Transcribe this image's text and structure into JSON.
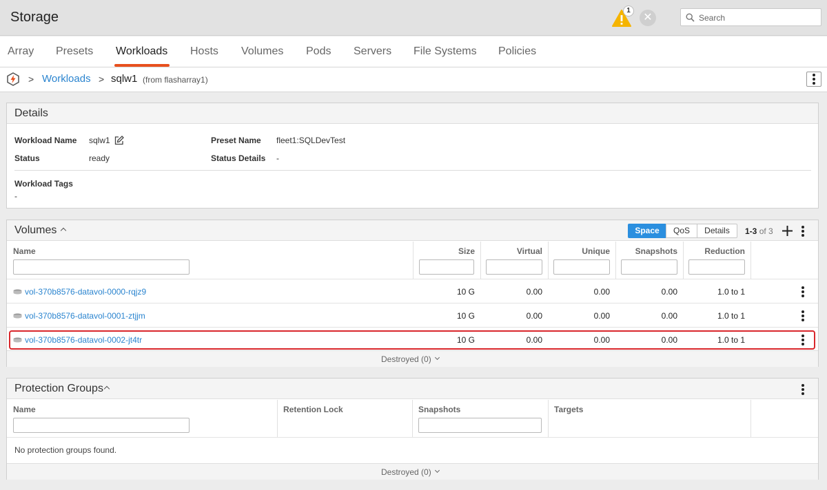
{
  "app": {
    "title": "Storage"
  },
  "header": {
    "alert_count": "1",
    "search_placeholder": "Search"
  },
  "tabs": [
    {
      "label": "Array"
    },
    {
      "label": "Presets"
    },
    {
      "label": "Workloads",
      "active": true
    },
    {
      "label": "Hosts"
    },
    {
      "label": "Volumes"
    },
    {
      "label": "Pods"
    },
    {
      "label": "Servers"
    },
    {
      "label": "File Systems"
    },
    {
      "label": "Policies"
    }
  ],
  "breadcrumb": {
    "sep": ">",
    "parent": "Workloads",
    "current": "sqlw1",
    "source": "(from flasharray1)"
  },
  "details": {
    "title": "Details",
    "workload_name_label": "Workload Name",
    "workload_name": "sqlw1",
    "status_label": "Status",
    "status": "ready",
    "preset_name_label": "Preset Name",
    "preset_name": "fleet1:SQLDevTest",
    "status_details_label": "Status Details",
    "status_details": "-",
    "tags_label": "Workload Tags",
    "tags": "-"
  },
  "volumes": {
    "title": "Volumes",
    "views": [
      "Space",
      "QoS",
      "Details"
    ],
    "active_view": "Space",
    "pagination": {
      "range": "1-3",
      "of": "of 3"
    },
    "columns": [
      "Name",
      "Size",
      "Virtual",
      "Unique",
      "Snapshots",
      "Reduction"
    ],
    "rows": [
      {
        "name": "vol-370b8576-datavol-0000-rqjz9",
        "size": "10 G",
        "virtual": "0.00",
        "unique": "0.00",
        "snapshots": "0.00",
        "reduction": "1.0 to 1"
      },
      {
        "name": "vol-370b8576-datavol-0001-ztjjm",
        "size": "10 G",
        "virtual": "0.00",
        "unique": "0.00",
        "snapshots": "0.00",
        "reduction": "1.0 to 1"
      },
      {
        "name": "vol-370b8576-datavol-0002-jt4tr",
        "size": "10 G",
        "virtual": "0.00",
        "unique": "0.00",
        "snapshots": "0.00",
        "reduction": "1.0 to 1",
        "highlighted": true
      }
    ],
    "destroyed": "Destroyed (0)"
  },
  "protection_groups": {
    "title": "Protection Groups",
    "columns": [
      "Name",
      "Retention Lock",
      "Snapshots",
      "Targets"
    ],
    "empty_text": "No protection groups found.",
    "destroyed": "Destroyed (0)"
  },
  "colors": {
    "accent_tab": "#e8501e",
    "link": "#2a84cf",
    "highlight": "#d9262b",
    "active_segment": "#2b8fdf",
    "warning": "#f5b400"
  }
}
